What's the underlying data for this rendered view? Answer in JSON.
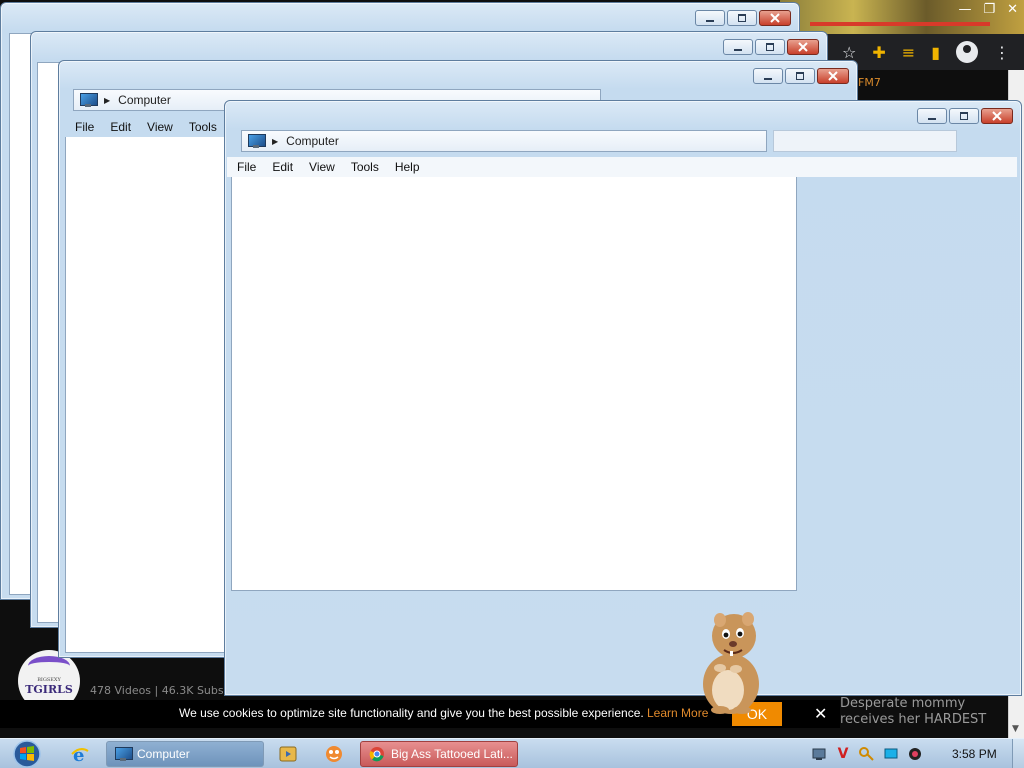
{
  "background_page": {
    "top_text": "FM7",
    "channel_logo_top": "BIGSEXY",
    "channel_logo_main": "TGIRLS",
    "channel_stats": "478 Videos | 46.3K Subs",
    "video_title": "Desperate mommy receives her HARDEST"
  },
  "cookie_banner": {
    "text": "We use cookies to optimize site functionality and give you the best possible experience.",
    "learn_more": "Learn More",
    "ok": "OK",
    "close": "✕"
  },
  "windows": [
    {
      "address": "Computer",
      "menus": [
        "File",
        "Edit",
        "View",
        "Tools"
      ]
    },
    {
      "address": "Computer",
      "menus": [
        "File",
        "Edit",
        "View",
        "Tools",
        "Help"
      ]
    }
  ],
  "taskbar": {
    "tasks": [
      {
        "label": "Computer"
      },
      {
        "label": "Big Ass Tattooed Lati..."
      }
    ],
    "clock": "3:58 PM"
  },
  "colors": {
    "cookie_ok_bg": "#f08a00",
    "learn_more": "#e08a2c",
    "chrome_task": "#c85a5a"
  }
}
